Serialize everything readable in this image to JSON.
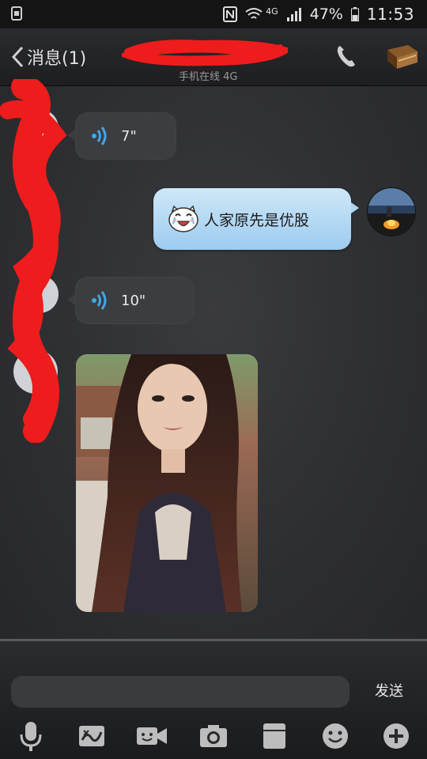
{
  "status_bar": {
    "network": "4G",
    "battery": "47%",
    "time": "11:53"
  },
  "nav": {
    "back_label": "消息(1)",
    "subtitle": "手机在线 4G"
  },
  "messages": [
    {
      "type": "voice",
      "side": "left",
      "duration": "7\""
    },
    {
      "type": "text",
      "side": "right",
      "text": "人家原先是优股"
    },
    {
      "type": "voice",
      "side": "left",
      "duration": "10\""
    },
    {
      "type": "image",
      "side": "left"
    }
  ],
  "composer": {
    "value": "",
    "send_label": "发送"
  },
  "toolbar": {
    "items": [
      "voice-mic",
      "doodle",
      "video-call",
      "camera",
      "file",
      "emoji",
      "plus"
    ]
  },
  "colors": {
    "incoming_bubble": "#3c3d40",
    "outgoing_bubble": "#9ccbef",
    "voice_wave": "#3fa7e8",
    "redaction": "#ee1c1c"
  }
}
